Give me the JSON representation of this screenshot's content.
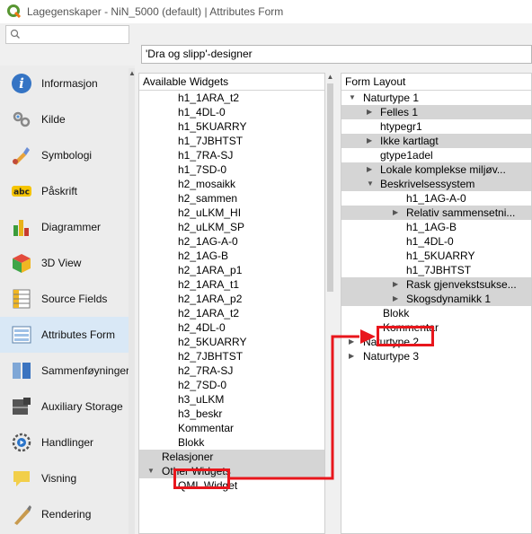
{
  "window": {
    "title": "Lagegenskaper - NiN_5000 (default) | Attributes Form"
  },
  "search": {
    "placeholder": ""
  },
  "designer": {
    "selected": "'Dra og slipp'-designer"
  },
  "sidebar": {
    "items": [
      {
        "label": "Informasjon",
        "icon": "info-icon"
      },
      {
        "label": "Kilde",
        "icon": "source-icon"
      },
      {
        "label": "Symbologi",
        "icon": "symbology-icon"
      },
      {
        "label": "Påskrift",
        "icon": "labels-icon",
        "badge": "abc"
      },
      {
        "label": "Diagrammer",
        "icon": "diagram-icon"
      },
      {
        "label": "3D View",
        "icon": "cube-icon"
      },
      {
        "label": "Source Fields",
        "icon": "fields-icon"
      },
      {
        "label": "Attributes Form",
        "icon": "form-icon"
      },
      {
        "label": "Sammenføyninger",
        "icon": "joins-icon"
      },
      {
        "label": "Auxiliary Storage",
        "icon": "storage-icon"
      },
      {
        "label": "Handlinger",
        "icon": "actions-icon"
      },
      {
        "label": "Visning",
        "icon": "display-icon"
      },
      {
        "label": "Rendering",
        "icon": "rendering-icon"
      }
    ]
  },
  "available": {
    "header": "Available Widgets",
    "items": [
      "h1_1ARA_t2",
      "h1_4DL-0",
      "h1_5KUARRY",
      "h1_7JBHTST",
      "h1_7RA-SJ",
      "h1_7SD-0",
      "h2_mosaikk",
      "h2_sammen",
      "h2_uLKM_HI",
      "h2_uLKM_SP",
      "h2_1AG-A-0",
      "h2_1AG-B",
      "h2_1ARA_p1",
      "h2_1ARA_t1",
      "h2_1ARA_p2",
      "h2_1ARA_t2",
      "h2_4DL-0",
      "h2_5KUARRY",
      "h2_7JBHTST",
      "h2_7RA-SJ",
      "h2_7SD-0",
      "h3_uLKM",
      "h3_beskr",
      "Kommentar",
      "Blokk"
    ],
    "relations": "Relasjoner",
    "other": "Other Widgets",
    "qml": "QML Widget"
  },
  "layout": {
    "header": "Form Layout",
    "root1": "Naturtype 1",
    "felles": "Felles 1",
    "htypegr": "htypegr1",
    "ikke": "Ikke kartlagt",
    "gtype": "gtype1adel",
    "lokale": "Lokale komplekse miljøv...",
    "beskr": "Beskrivelsessystem",
    "b1": "h1_1AG-A-0",
    "relativ": "Relativ sammensetni...",
    "b2": "h1_1AG-B",
    "b3": "h1_4DL-0",
    "b4": "h1_5KUARRY",
    "b5": "h1_7JBHTST",
    "rask": "Rask gjenvekstsukse...",
    "skog": "Skogsdynamikk 1",
    "blokk": "Blokk",
    "kommentar": "Kommentar",
    "root2": "Naturtype 2",
    "root3": "Naturtype 3"
  },
  "colors": {
    "highlight": "#e8161c",
    "active_item": "#d9e8f6",
    "group_row": "#d5d5d5"
  }
}
